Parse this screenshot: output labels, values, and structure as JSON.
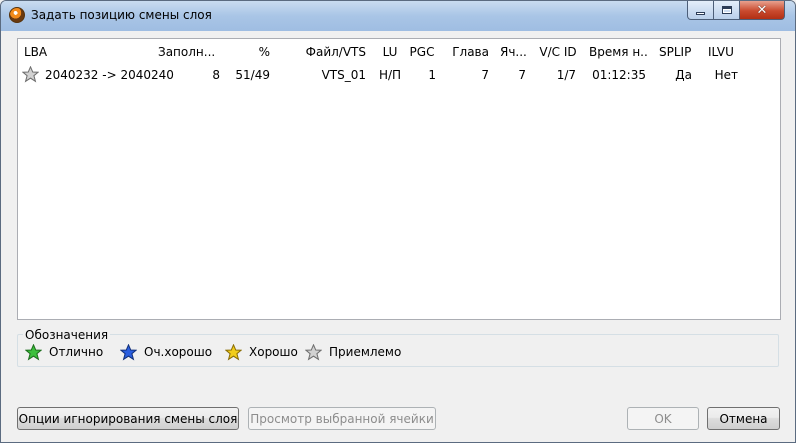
{
  "window": {
    "title": "Задать позицию смены слоя",
    "close_glyph": "✕"
  },
  "table": {
    "columns": [
      "LBA",
      "Заполн...",
      "%",
      "Файл/VTS",
      "LU",
      "PGC",
      "Глава",
      "Яч...",
      "V/C ID",
      "Время н...",
      "SPLIP",
      "ILVU"
    ],
    "rows": [
      {
        "icon": "star-gray-icon",
        "lba": "2040232 -> 2040240",
        "fill": "8",
        "percent": "51/49",
        "file_vts": "VTS_01",
        "lu": "Н/П",
        "pgc": "1",
        "chapter": "7",
        "cell": "7",
        "vc_id": "1/7",
        "time": "01:12:35",
        "splip": "Да",
        "ilvu": "Нет"
      }
    ]
  },
  "legend": {
    "title": "Обозначения",
    "items": [
      {
        "label": "Отлично",
        "color": "#2fa82f",
        "icon": "star-green-icon"
      },
      {
        "label": "Оч.хорошо",
        "color": "#1f4fd1",
        "icon": "star-blue-icon"
      },
      {
        "label": "Хорошо",
        "color": "#e8c416",
        "icon": "star-yellow-icon"
      },
      {
        "label": "Приемлемо",
        "color": "#b4b4b4",
        "icon": "star-gray-icon"
      }
    ]
  },
  "buttons": {
    "ignore_options": "Опции игнорирования смены слоя",
    "preview_cell": "Просмотр выбранной ячейки",
    "ok": "OK",
    "cancel": "Отмена"
  }
}
